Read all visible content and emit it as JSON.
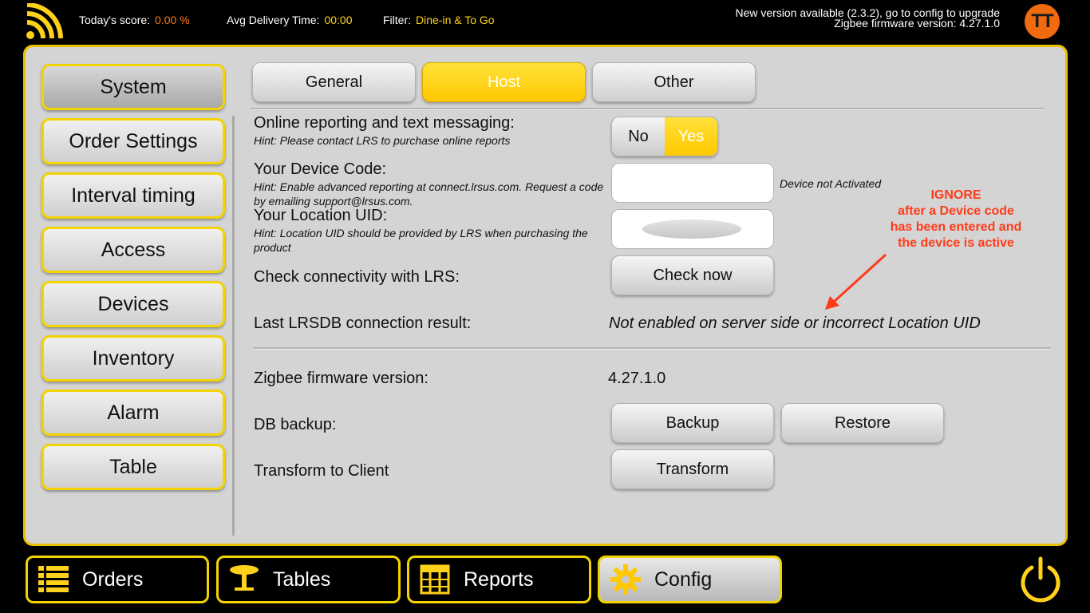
{
  "topbar": {
    "score_label": "Today's score:",
    "score_value": "0.00 %",
    "avg_label": "Avg Delivery Time:",
    "avg_value": "00:00",
    "filter_label": "Filter:",
    "filter_value": "Dine-in & To Go",
    "notice_line1": "New version available (2.3.2), go to config to upgrade",
    "notice_line2": "Zigbee firmware version: 4.27.1.0",
    "avatar": "TT"
  },
  "sidebar": {
    "items": [
      {
        "label": "System"
      },
      {
        "label": "Order Settings"
      },
      {
        "label": "Interval timing"
      },
      {
        "label": "Access"
      },
      {
        "label": "Devices"
      },
      {
        "label": "Inventory"
      },
      {
        "label": "Alarm"
      },
      {
        "label": "Table"
      }
    ]
  },
  "tabs": [
    {
      "label": "General"
    },
    {
      "label": "Host"
    },
    {
      "label": "Other"
    }
  ],
  "form": {
    "online_label": "Online reporting and text messaging:",
    "online_hint": "Hint: Please contact LRS to purchase online reports",
    "toggle_no": "No",
    "toggle_yes": "Yes",
    "device_label": "Your Device Code:",
    "device_hint": "Hint: Enable advanced reporting at connect.lrsus.com. Request a code by emailing support@lrsus.com.",
    "device_status": "Device not Activated",
    "location_label": "Your Location UID:",
    "location_hint": "Hint: Location UID should be provided by LRS when purchasing the product",
    "check_label": "Check connectivity with LRS:",
    "check_button": "Check now",
    "last_label": "Last LRSDB connection result:",
    "last_value": "Not enabled on server side or incorrect Location UID",
    "zigbee_label": "Zigbee firmware version:",
    "zigbee_value": "4.27.1.0",
    "db_label": "DB backup:",
    "backup_button": "Backup",
    "restore_button": "Restore",
    "transform_label": "Transform to Client",
    "transform_button": "Transform"
  },
  "annotation": {
    "line1": "IGNORE",
    "line2": "after a Device code",
    "line3": "has been entered and",
    "line4": "the device is active"
  },
  "bottom_nav": [
    {
      "label": "Orders"
    },
    {
      "label": "Tables"
    },
    {
      "label": "Reports"
    },
    {
      "label": "Config"
    }
  ],
  "colors": {
    "accent_yellow": "#ffd11a",
    "accent_orange": "#ff7a1a",
    "annotation_red": "#ff3b1a"
  }
}
